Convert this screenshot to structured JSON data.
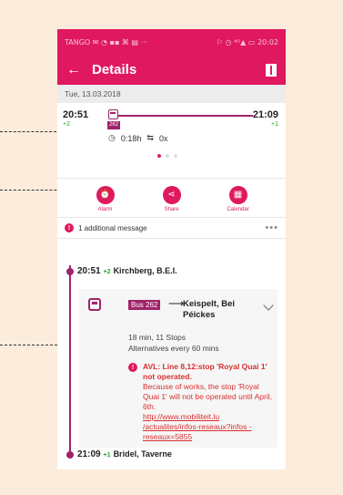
{
  "status_bar": {
    "left": "TANGO ✉ ◔ ▪▪ ⌘ ▤ ···",
    "right": "⚐ ◷ ⁴ᴳ▲ ▭ 20:02"
  },
  "app_bar": {
    "title": "Details",
    "back_icon": "arrow-left-icon",
    "map_icon": "map-icon"
  },
  "date": "Tue, 13.03.2018",
  "trip_summary": {
    "departure_time": "20:51",
    "departure_delay": "+2",
    "arrival_time": "21:09",
    "arrival_delay": "+1",
    "line_badge": "262",
    "duration": "0:18h",
    "transfers": "0x",
    "page_dots": 3,
    "active_dot": 0
  },
  "actions": [
    {
      "label": "Alarm",
      "icon": "alarm-clock-icon"
    },
    {
      "label": "Share",
      "icon": "share-icon"
    },
    {
      "label": "Calendar",
      "icon": "calendar-icon"
    }
  ],
  "message_bar": {
    "text": "1 additional message",
    "more": "•••"
  },
  "journey": {
    "start": {
      "time": "20:51",
      "delay": "+2",
      "stop": "Kirchberg, B.E.I."
    },
    "leg": {
      "badge": "Bus 262",
      "arrow": "⟶",
      "destination": "Keispelt, Bei Péickes",
      "stops_info": "18 min, 11 Stops",
      "alternatives": "Alternatives every 60 mins",
      "alert_icon": "!",
      "alert_title": "AVL: Line 8,12:stop 'Royal Quai 1' not operated.",
      "alert_body": "Because of works, the stop 'Royal Quai 1' will not be operated until April, 6th.",
      "alert_link": "http://www.mobiliteit.lu /actualites/infos-reseaux?infos -reseaux=5855"
    },
    "end": {
      "time": "21:09",
      "delay": "+1",
      "stop": "Bridel, Taverne"
    }
  },
  "colors": {
    "accent": "#e0185f",
    "line": "#a0226b",
    "delay_ok": "#2aa52a",
    "alert": "#d93030",
    "background": "#fbecdc"
  }
}
